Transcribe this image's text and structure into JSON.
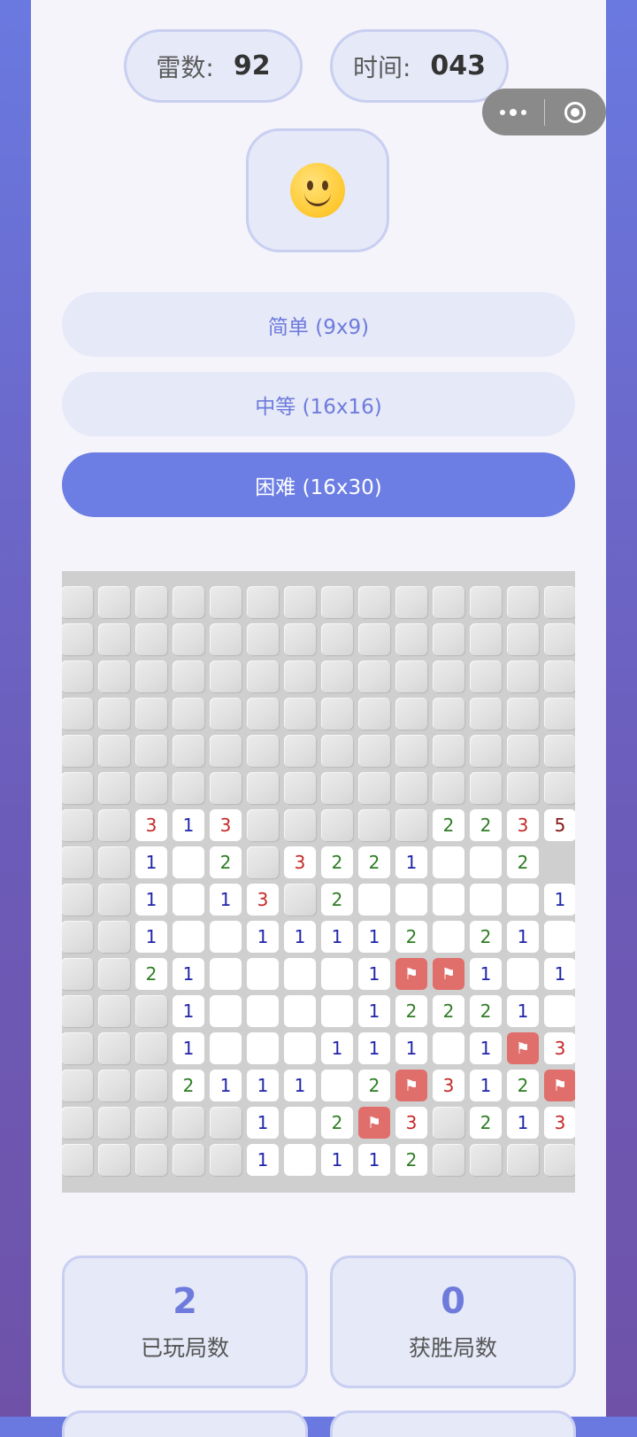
{
  "counter": {
    "mines_label": "雷数:",
    "mines_value": "92",
    "time_label": "时间:",
    "time_value": "043"
  },
  "face": {
    "icon": "smiley-face-icon",
    "state": "playing"
  },
  "modes": [
    {
      "label": "简单 (9x9)",
      "active": false
    },
    {
      "label": "中等 (16x16)",
      "active": false
    },
    {
      "label": "困难 (16x30)",
      "active": true
    }
  ],
  "board": {
    "visible_rows": [
      "##############",
      "##############",
      "##############",
      "##############",
      "##############",
      "##############",
      "##313#####2235",
      "##1.2#3221..2",
      "##1.13#2.....1",
      "##1..11112 21.",
      "##21....1FF1.1",
      "###1....12221 2",
      "###1...111.1F3",
      "###2111.2F312FF",
      "#####1.2F3#213",
      "#####1.112####"
    ],
    "legend": {
      "#": "hidden",
      ".": "open-empty",
      "F": "flag",
      "digit": "adjacent mines"
    },
    "number_colors": {
      "1": "#1f25a8",
      "2": "#2e7d24",
      "3": "#c62828",
      "5": "#8a1414"
    },
    "flag_icon": "flag-icon"
  },
  "stats": [
    {
      "value": "2",
      "label": "已玩局数"
    },
    {
      "value": "0",
      "label": "获胜局数"
    }
  ]
}
